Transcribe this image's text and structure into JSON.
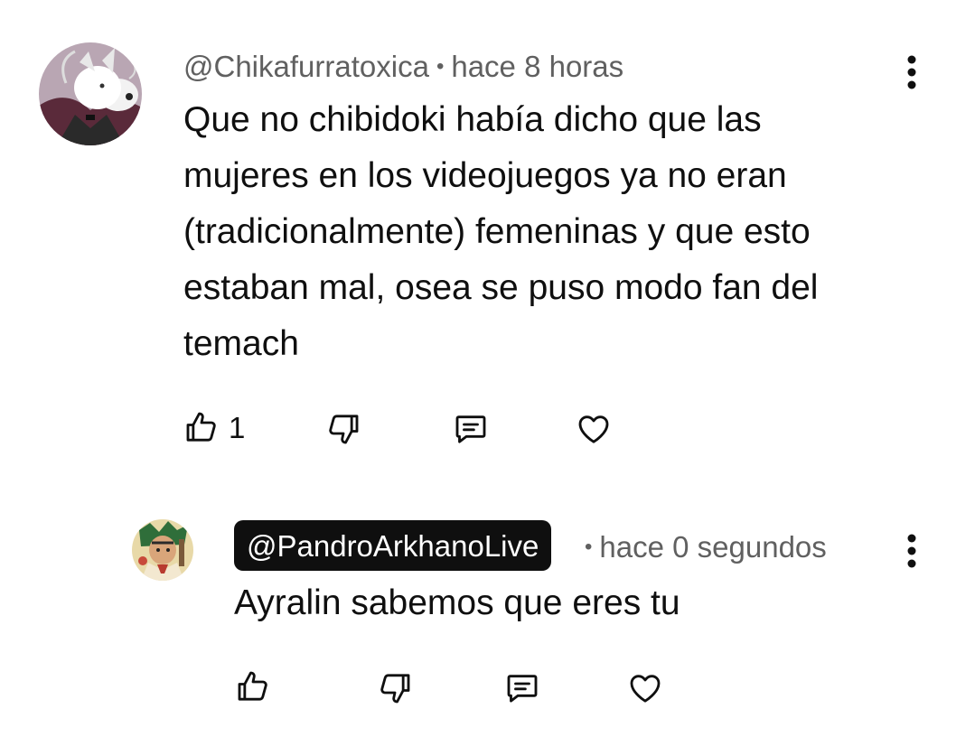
{
  "comment": {
    "author": "@Chikafurratoxica",
    "separator": "•",
    "time": "hace 8 horas",
    "text": "Que no chibidoki había dicho que las\nmujeres en los videojuegos ya no eran\n(tradicionalmente) femeninas y que esto\nestaban mal, osea se puso modo fan del\ntemach",
    "like_count": "1",
    "avatar_icon": "white-dog-avatar-icon",
    "colors": {
      "avatar_bg": "#8a6b7d",
      "text": "#0f0f0f",
      "meta": "#606060"
    }
  },
  "reply": {
    "author": "@PandroArkhanoLive",
    "separator": "•",
    "time": "hace 0 segundos",
    "text": "Ayralin sabemos que eres tu",
    "avatar_icon": "anime-character-avatar-icon",
    "colors": {
      "chip_bg": "#0f0f0f",
      "chip_text": "#ffffff"
    }
  },
  "icons": {
    "like": "thumbs-up-icon",
    "dislike": "thumbs-down-icon",
    "reply": "comment-icon",
    "heart": "heart-icon",
    "menu": "more-vert-icon"
  }
}
